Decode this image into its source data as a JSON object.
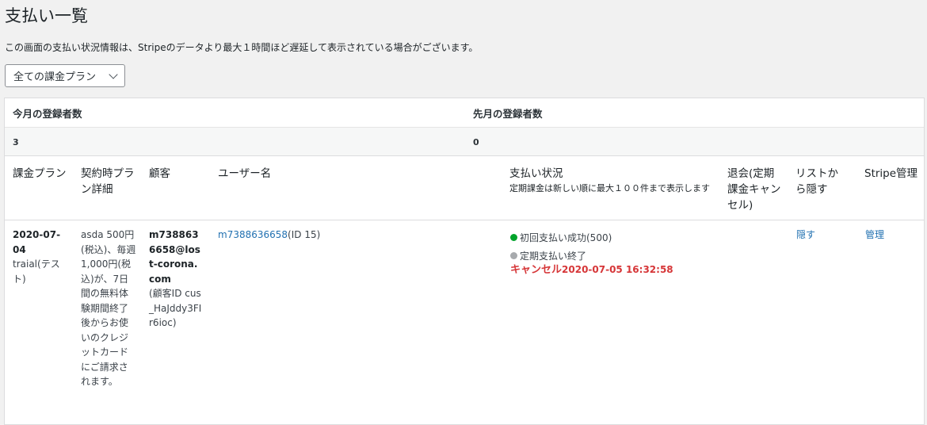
{
  "page": {
    "title": "支払い一覧",
    "notice": "この画面の支払い状況情報は、Stripeのデータより最大１時間ほど遅延して表示されている場合がございます。"
  },
  "filter": {
    "selected": "全ての課金プラン"
  },
  "stats": {
    "this_month_label": "今月の登録者数",
    "last_month_label": "先月の登録者数",
    "this_month_value": "3",
    "last_month_value": "0"
  },
  "table": {
    "headers": {
      "plan": "課金プラン",
      "plan_detail": "契約時プラン詳細",
      "customer": "顧客",
      "username": "ユーザー名",
      "status": "支払い状況",
      "status_sub": "定期課金は新しい順に最大１００件まで表示します",
      "cancel": "退会(定期課金キャンセル)",
      "hide": "リストから隠す",
      "stripe": "Stripe管理"
    },
    "rows": [
      {
        "plan_date": "2020-07-04",
        "plan_name": "traial(テスト)",
        "plan_detail": "asda 500円(税込)、毎週 1,000円(税込)が、7日間の無料体験期間終了後からお使いのクレジットカードにご請求されます。",
        "customer_email": "m7388636658@lost-corona.com",
        "customer_id": "(顧客ID cus_HaJddy3FIr6ioc)",
        "username_link": "m7388636658",
        "username_suffix": "(ID 15)",
        "status_1": "初回支払い成功(500)",
        "status_2": "定期支払い終了",
        "cancel_label": "キャンセル",
        "cancel_time": "2020-07-05 16:32:58",
        "hide_link": "隠す",
        "manage_link": "管理"
      }
    ]
  },
  "colors": {
    "link": "#2271b1",
    "success": "#00a32a",
    "ended": "#a7aaad",
    "cancel": "#d63638"
  }
}
